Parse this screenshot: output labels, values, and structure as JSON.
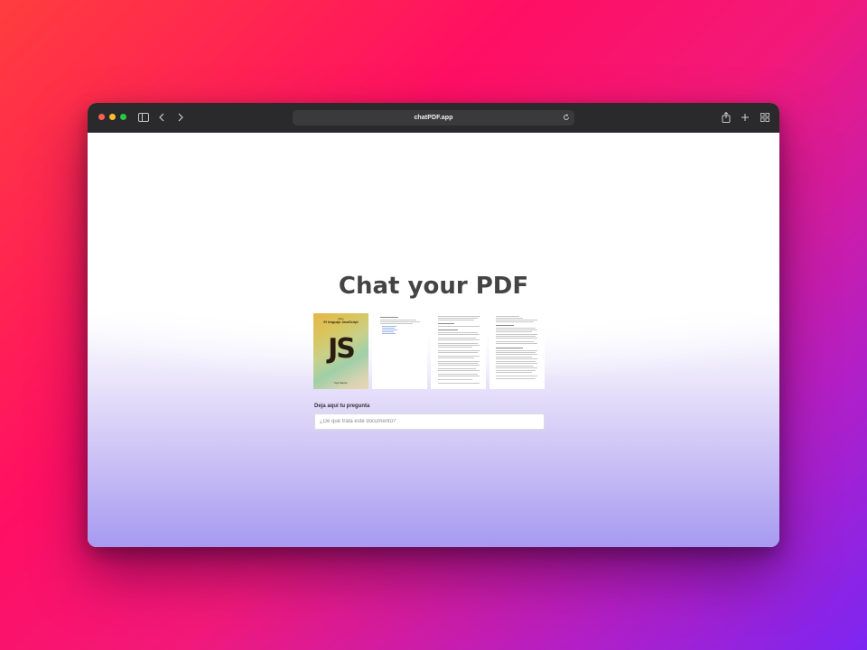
{
  "browser": {
    "url": "chatPDF.app"
  },
  "page": {
    "title": "Chat your PDF",
    "question_label": "Deja aquí tu pregunta",
    "question_placeholder": "¿De qué trata este documento?"
  },
  "pdf_preview": {
    "cover": {
      "series": "Libro",
      "subtitle": "El lenguaje JavaScript",
      "logo_text": "JS",
      "author": "Ilya Kantor"
    }
  },
  "colors": {
    "toolbar": "#2a2a2c",
    "address_bar": "#3a3a3c",
    "title": "#444444",
    "traffic_red": "#ff5f57",
    "traffic_yellow": "#febc2e",
    "traffic_green": "#28c840"
  },
  "icons": [
    "sidebar-toggle-icon",
    "chevron-left-icon",
    "chevron-right-icon",
    "reload-icon",
    "share-icon",
    "plus-icon",
    "tab-overview-icon"
  ]
}
